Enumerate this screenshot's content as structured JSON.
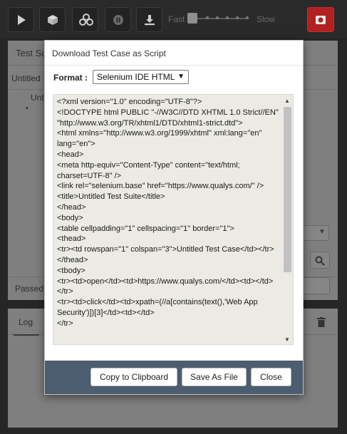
{
  "toolbar": {
    "speed_fast_label": "Fast",
    "speed_slow_label": "Slow",
    "speed_value": 0,
    "record_color": "#b22020"
  },
  "background": {
    "panel_title_truncated": "Test Su",
    "tree_item_1": "Untitled",
    "tree_item_2": "Unt",
    "status_label": "Passed",
    "log_tab": "Log"
  },
  "dialog": {
    "title": "Download Test Case as Script",
    "format_label": "Format :",
    "format_value": "Selenium IDE HTML",
    "script_code": "<?xml version=\"1.0\" encoding=\"UTF-8\"?>\n<!DOCTYPE html PUBLIC \"-//W3C//DTD XHTML 1.0 Strict//EN\" \"http://www.w3.org/TR/xhtml1/DTD/xhtml1-strict.dtd\">\n<html xmlns=\"http://www.w3.org/1999/xhtml\" xml:lang=\"en\" lang=\"en\">\n<head>\n<meta http-equiv=\"Content-Type\" content=\"text/html; charset=UTF-8\" />\n<link rel=\"selenium.base\" href=\"https://www.qualys.com/\" />\n<title>Untitled Test Suite</title>\n</head>\n<body>\n<table cellpadding=\"1\" cellspacing=\"1\" border=\"1\">\n<thead>\n<tr><td rowspan=\"1\" colspan=\"3\">Untitled Test Case</td></tr>\n</thead>\n<tbody>\n<tr><td>open</td><td>https://www.qualys.com/</td><td></td>\n</tr>\n<tr><td>click</td><td>xpath=(//a[contains(text(),'Web App Security')])[3]</td><td></td>\n</tr>",
    "buttons": {
      "copy": "Copy to Clipboard",
      "save": "Save As File",
      "close": "Close"
    }
  }
}
